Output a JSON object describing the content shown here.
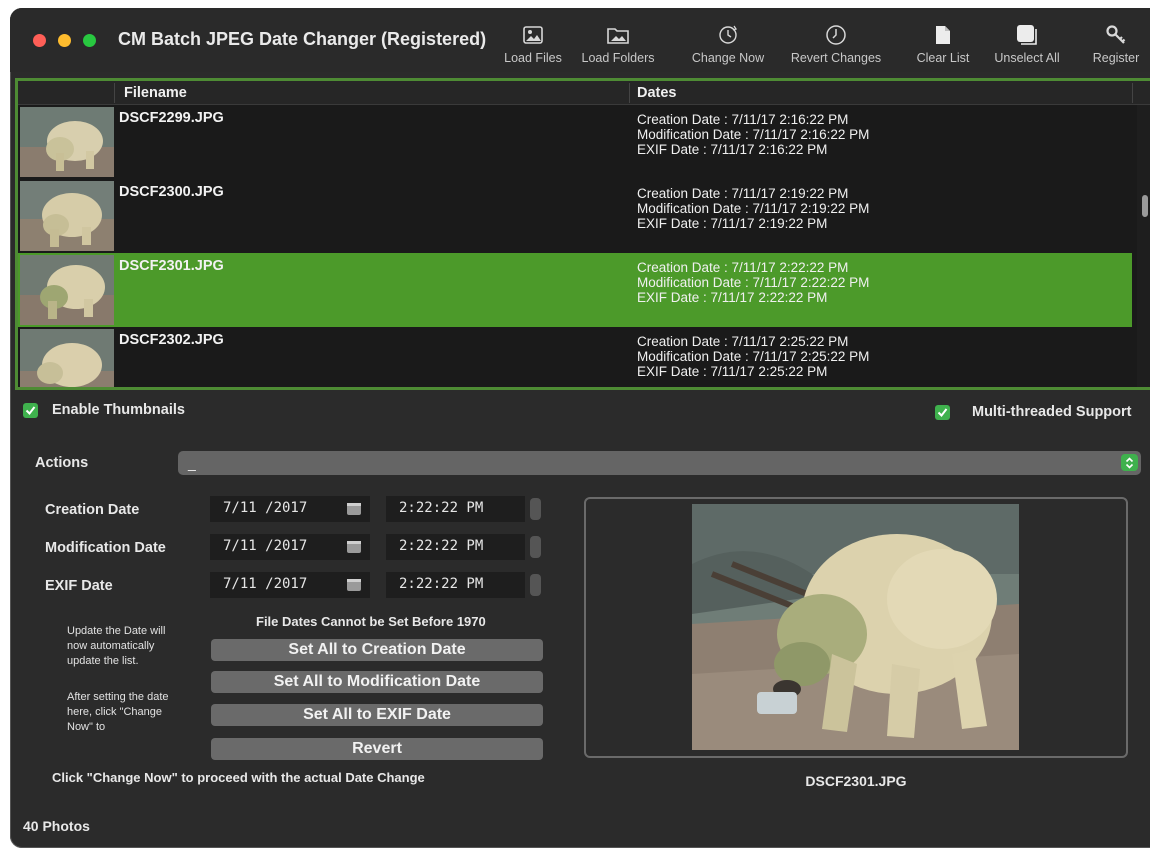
{
  "window": {
    "title": "CM Batch JPEG Date Changer (Registered)"
  },
  "toolbar": {
    "load_files": "Load Files",
    "load_folders": "Load Folders",
    "change_now": "Change Now",
    "revert_changes": "Revert Changes",
    "clear_list": "Clear List",
    "unselect_all": "Unselect All",
    "register": "Register"
  },
  "list": {
    "col_filename": "Filename",
    "col_dates": "Dates",
    "rows": [
      {
        "filename": "DSCF2299.JPG",
        "creation": "Creation Date : 7/11/17 2:16:22 PM",
        "modification": "Modification Date : 7/11/17 2:16:22 PM",
        "exif": "EXIF Date : 7/11/17 2:16:22 PM"
      },
      {
        "filename": "DSCF2300.JPG",
        "creation": "Creation Date : 7/11/17 2:19:22 PM",
        "modification": "Modification Date : 7/11/17 2:19:22 PM",
        "exif": "EXIF Date : 7/11/17 2:19:22 PM"
      },
      {
        "filename": "DSCF2301.JPG",
        "creation": "Creation Date : 7/11/17 2:22:22 PM",
        "modification": "Modification Date : 7/11/17 2:22:22 PM",
        "exif": "EXIF Date : 7/11/17 2:22:22 PM",
        "selected": true
      },
      {
        "filename": "DSCF2302.JPG",
        "creation": "Creation Date : 7/11/17 2:25:22 PM",
        "modification": "Modification Date : 7/11/17 2:25:22 PM",
        "exif": "EXIF Date : 7/11/17 2:25:22 PM"
      }
    ]
  },
  "options": {
    "enable_thumbnails": "Enable Thumbnails",
    "multithreaded": "Multi-threaded Support"
  },
  "actions": {
    "label": "Actions",
    "value": "_"
  },
  "dates": {
    "creation": {
      "label": "Creation Date",
      "date": "7/11 /2017",
      "time": "2:22:22 PM"
    },
    "modification": {
      "label": "Modification Date",
      "date": "7/11 /2017",
      "time": "2:22:22 PM"
    },
    "exif": {
      "label": "EXIF Date",
      "date": "7/11 /2017",
      "time": "2:22:22 PM"
    }
  },
  "notes": {
    "min_year": "File Dates Cannot be Set Before 1970",
    "side_1": "Update the Date will now automatically update the list.",
    "side_2": "After setting the date here,  click \"Change Now\" to",
    "bottom": "Click \"Change Now\" to proceed with the actual Date Change"
  },
  "buttons": {
    "set_creation": "Set All to Creation Date",
    "set_modification": "Set All to Modification Date",
    "set_exif": "Set All to EXIF Date",
    "revert": "Revert"
  },
  "preview": {
    "filename": "DSCF2301.JPG"
  },
  "status": {
    "count": "40 Photos"
  },
  "colors": {
    "accent_green": "#4c9a2a",
    "checkbox_green": "#3fb14d",
    "window_bg": "#2b2b2b"
  }
}
